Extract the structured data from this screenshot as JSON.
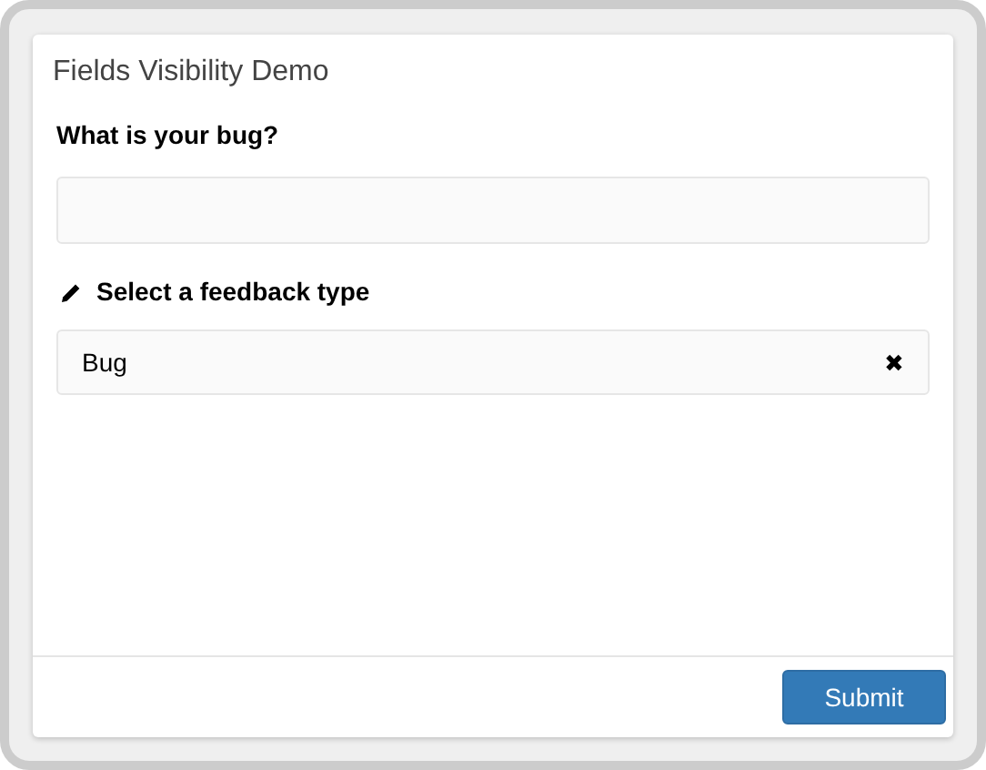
{
  "window": {
    "title": "Fields Visibility Demo"
  },
  "fields": [
    {
      "kind": "text",
      "label": "What is your bug?"
    },
    {
      "kind": "select",
      "label": "Select a feedback type",
      "value": "Bug",
      "clear": "✖"
    }
  ],
  "buttons": [
    "Submit"
  ]
}
